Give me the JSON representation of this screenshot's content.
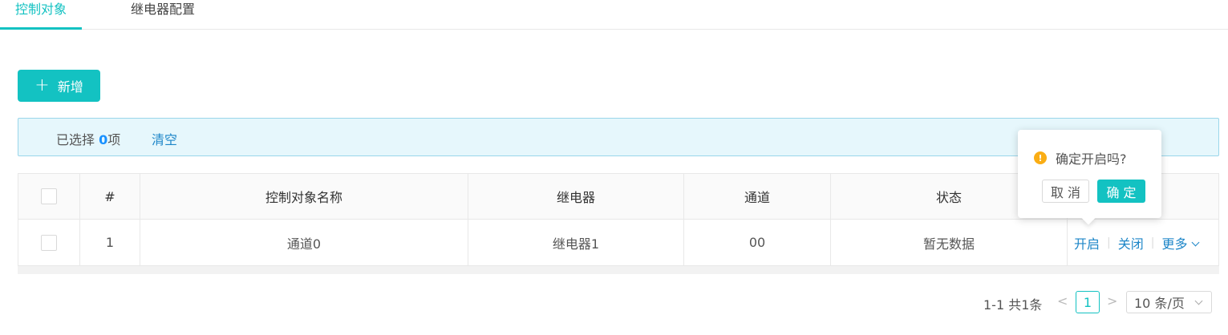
{
  "tabs": [
    {
      "label": "控制对象"
    },
    {
      "label": "继电器配置"
    }
  ],
  "toolbar": {
    "add_label": "新增",
    "add_icon": "plus-icon"
  },
  "selection": {
    "prefix": "已选择 ",
    "count": "0",
    "suffix": "项",
    "clear_label": "清空"
  },
  "table": {
    "columns": [
      "#",
      "控制对象名称",
      "继电器",
      "通道",
      "状态"
    ],
    "rows": [
      {
        "index": "1",
        "name": "通道0",
        "relay": "继电器1",
        "channel": "00",
        "status": "暂无数据"
      }
    ],
    "actions": {
      "open": "开启",
      "close": "关闭",
      "more": "更多"
    }
  },
  "popconfirm": {
    "message": "确定开启吗?",
    "icon": "!",
    "cancel_label": "取 消",
    "ok_label": "确 定"
  },
  "pagination": {
    "total_text": "1-1 共1条",
    "prev": "<",
    "next": ">",
    "current_page": "1",
    "page_size": "10 条/页"
  },
  "colors": {
    "accent": "#13c2c2",
    "link": "#1d86c8",
    "warning": "#faad14"
  }
}
